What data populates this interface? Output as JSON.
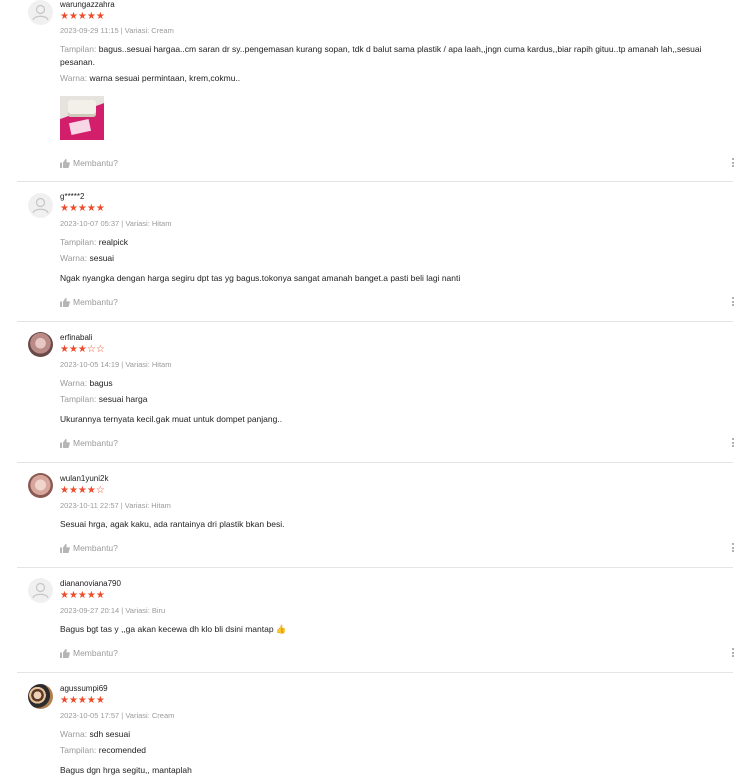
{
  "helpful_label": "Membantu?",
  "accent_color": "#ee4d2d",
  "reviews": [
    {
      "username": "warungazzahra",
      "rating": 5,
      "stars": "★★★★★",
      "meta": "2023-09-29 11:15 | Variasi: Cream",
      "lines": [
        {
          "label": "Tampilan:",
          "value": "bagus..sesuai hargaa..cm saran dr sy..pengemasan kurang sopan, tdk d balut sama plastik / apa laah,,jngn cuma kardus,,biar rapih gituu..tp amanah lah,,sesuai pesanan."
        },
        {
          "label": "Warna:",
          "value": "warna sesuai permintaan, krem,cokmu.."
        }
      ],
      "has_photo": true
    },
    {
      "username": "g*****2",
      "rating": 5,
      "stars": "★★★★★",
      "meta": "2023-10-07 05:37 | Variasi: Hitam",
      "lines": [
        {
          "label": "Tampilan:",
          "value": "realpick"
        },
        {
          "label": "Warna:",
          "value": "sesuai"
        }
      ],
      "comment": "Ngak nyangka dengan harga segiru dpt tas yg bagus.tokonya sangat amanah banget.a pasti beli lagi nanti"
    },
    {
      "username": "erfinabali",
      "rating": 3,
      "stars_on": "★★★",
      "stars_off": "☆☆",
      "meta": "2023-10-05 14:19 | Variasi: Hitam",
      "lines": [
        {
          "label": "Warna:",
          "value": "bagus"
        },
        {
          "label": "Tampilan:",
          "value": "sesuai harga"
        }
      ],
      "comment": "Ukurannya ternyata kecil.gak muat untuk dompet panjang.."
    },
    {
      "username": "wulan1yuni2k",
      "rating": 4,
      "stars_on": "★★★★",
      "stars_off": "☆",
      "meta": "2023-10-11 22:57 | Variasi: Hitam",
      "comment": "Sesuai hrga, agak kaku, ada rantainya dri plastik bkan besi."
    },
    {
      "username": "diananoviana790",
      "rating": 5,
      "stars": "★★★★★",
      "meta": "2023-09-27 20:14 | Variasi: Biru",
      "comment": "Bagus bgt tas y ,,ga akan kecewa dh klo bli dsini mantap 👍"
    },
    {
      "username": "agussumpi69",
      "rating": 5,
      "stars": "★★★★★",
      "meta": "2023-10-05 17:57 | Variasi: Cream",
      "lines": [
        {
          "label": "Warna:",
          "value": "sdh sesuai"
        },
        {
          "label": "Tampilan:",
          "value": "recomended"
        }
      ],
      "comment": "Bagus dgn hrga segitu,, mantaplah"
    }
  ]
}
